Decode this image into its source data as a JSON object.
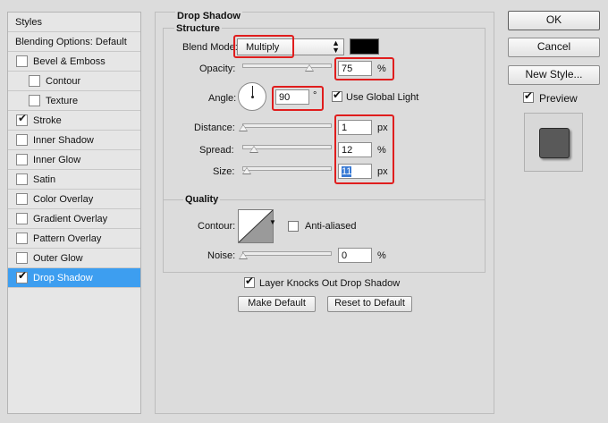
{
  "styles_panel": {
    "header": "Styles",
    "items": [
      {
        "label": "Blending Options: Default",
        "checkbox": false,
        "checked": false,
        "indent": false,
        "selected": false
      },
      {
        "label": "Bevel & Emboss",
        "checkbox": true,
        "checked": false,
        "indent": false,
        "selected": false
      },
      {
        "label": "Contour",
        "checkbox": true,
        "checked": false,
        "indent": true,
        "selected": false
      },
      {
        "label": "Texture",
        "checkbox": true,
        "checked": false,
        "indent": true,
        "selected": false
      },
      {
        "label": "Stroke",
        "checkbox": true,
        "checked": true,
        "indent": false,
        "selected": false
      },
      {
        "label": "Inner Shadow",
        "checkbox": true,
        "checked": false,
        "indent": false,
        "selected": false
      },
      {
        "label": "Inner Glow",
        "checkbox": true,
        "checked": false,
        "indent": false,
        "selected": false
      },
      {
        "label": "Satin",
        "checkbox": true,
        "checked": false,
        "indent": false,
        "selected": false
      },
      {
        "label": "Color Overlay",
        "checkbox": true,
        "checked": false,
        "indent": false,
        "selected": false
      },
      {
        "label": "Gradient Overlay",
        "checkbox": true,
        "checked": false,
        "indent": false,
        "selected": false
      },
      {
        "label": "Pattern Overlay",
        "checkbox": true,
        "checked": false,
        "indent": false,
        "selected": false
      },
      {
        "label": "Outer Glow",
        "checkbox": true,
        "checked": false,
        "indent": false,
        "selected": false
      },
      {
        "label": "Drop Shadow",
        "checkbox": true,
        "checked": true,
        "indent": false,
        "selected": true
      }
    ]
  },
  "drop_shadow": {
    "title": "Drop Shadow",
    "structure": {
      "title": "Structure",
      "blend_mode_label": "Blend Mode:",
      "blend_mode_value": "Multiply",
      "shadow_color": "#000000",
      "opacity_label": "Opacity:",
      "opacity_value": "75",
      "opacity_unit": "%",
      "opacity_level": 0.75,
      "angle_label": "Angle:",
      "angle_value": "90",
      "angle_unit": "°",
      "use_global_light_label": "Use Global Light",
      "use_global_light_checked": true,
      "distance_label": "Distance:",
      "distance_value": "1",
      "distance_unit": "px",
      "distance_level": 0.0,
      "spread_label": "Spread:",
      "spread_value": "12",
      "spread_unit": "%",
      "spread_level": 0.12,
      "size_label": "Size:",
      "size_value": "11",
      "size_unit": "px",
      "size_level": 0.045
    },
    "quality": {
      "title": "Quality",
      "contour_label": "Contour:",
      "anti_aliased_label": "Anti-aliased",
      "anti_aliased_checked": false,
      "noise_label": "Noise:",
      "noise_value": "0",
      "noise_unit": "%",
      "noise_level": 0.0
    },
    "layer_knocks_out_label": "Layer Knocks Out Drop Shadow",
    "layer_knocks_out_checked": true,
    "make_default_label": "Make Default",
    "reset_default_label": "Reset to Default"
  },
  "right_panel": {
    "ok_label": "OK",
    "cancel_label": "Cancel",
    "new_style_label": "New Style...",
    "preview_label": "Preview",
    "preview_checked": true
  },
  "colors": {
    "selection": "#3d9ef0",
    "highlight_box": "#e01d1d",
    "preview_swatch": "#595959"
  }
}
